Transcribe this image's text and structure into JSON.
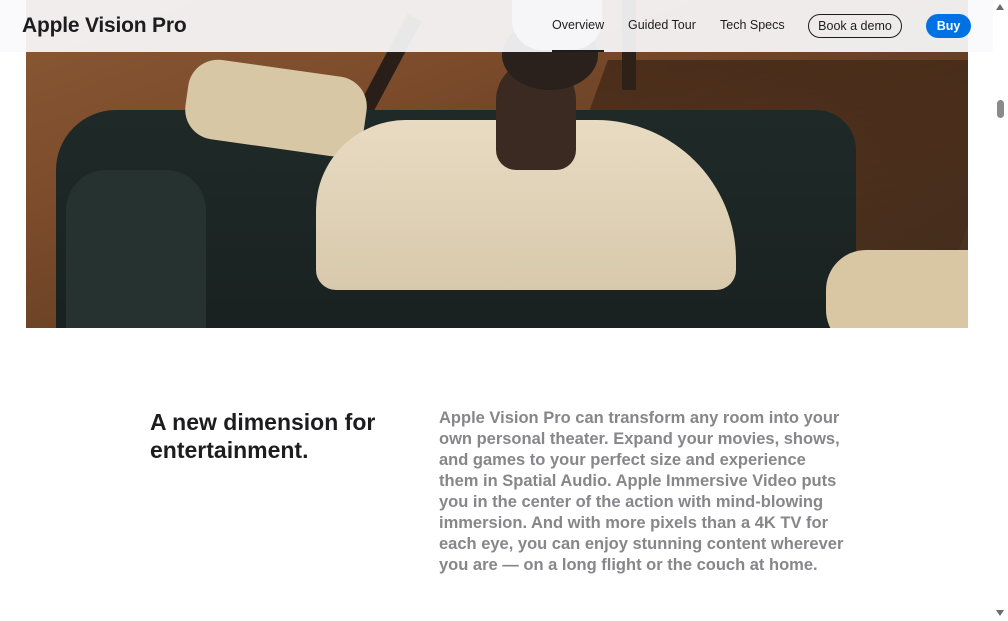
{
  "nav": {
    "product_title": "Apple Vision Pro",
    "links": [
      "Overview",
      "Guided Tour",
      "Tech Specs"
    ],
    "demo_button": "Book a demo",
    "buy_button": "Buy",
    "active_tab": "Overview"
  },
  "section": {
    "headline": "A new dimension for entertainment.",
    "body": "Apple Vision Pro can transform any room into your own personal theater. Expand your movies, shows, and games to your perfect size and experience them in Spatial Audio. Apple Immersive Video puts you in the center of the action with mind-blowing immersion. And with more pixels than a 4K TV for each eye, you can enjoy stunning content wherever you are — on a long flight or the couch at home."
  },
  "colors": {
    "accent": "#0071e3",
    "text_primary": "#1d1d1f",
    "text_secondary": "#86868b"
  },
  "icons": [
    "scroll-up-arrow-icon",
    "scroll-down-arrow-icon"
  ]
}
